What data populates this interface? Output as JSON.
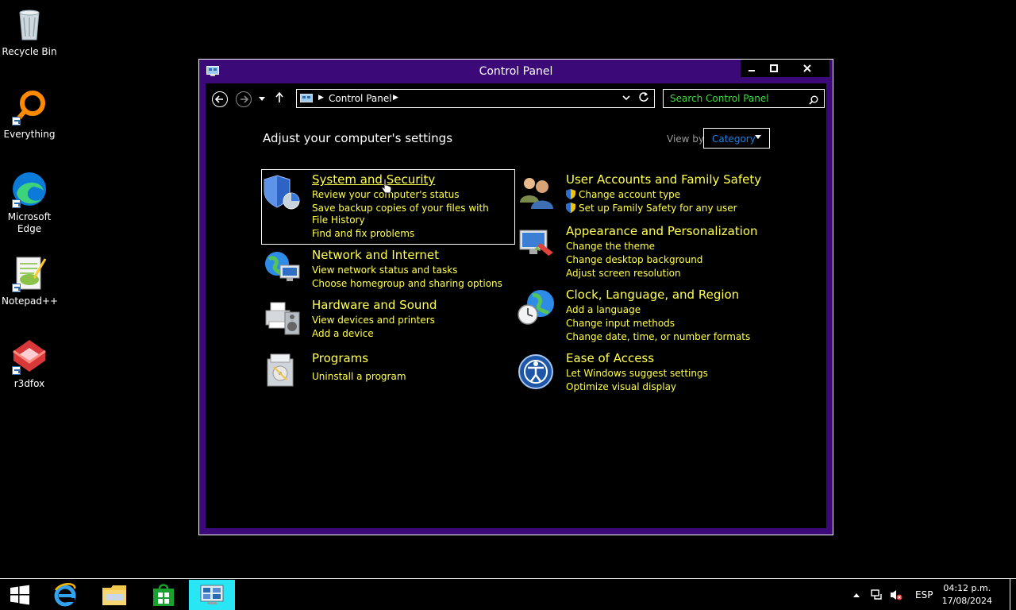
{
  "desktop": {
    "icons": [
      {
        "label": "Recycle Bin"
      },
      {
        "label": "Everything"
      },
      {
        "label": "Microsoft Edge"
      },
      {
        "label": "Notepad++"
      },
      {
        "label": "r3dfox"
      }
    ]
  },
  "window": {
    "title": "Control Panel",
    "controls": {
      "minimize": "–",
      "maximize": "□",
      "close": "✕"
    },
    "address": {
      "crumb": "Control Panel"
    },
    "search": {
      "placeholder": "Search Control Panel"
    },
    "heading": "Adjust your computer's settings",
    "view_by": {
      "label": "View by:",
      "value": "Category"
    },
    "categories": {
      "system": {
        "title": "System and Security",
        "links": [
          "Review your computer's status",
          "Save backup copies of your files with File History",
          "Find and fix problems"
        ]
      },
      "network": {
        "title": "Network and Internet",
        "links": [
          "View network status and tasks",
          "Choose homegroup and sharing options"
        ]
      },
      "hardware": {
        "title": "Hardware and Sound",
        "links": [
          "View devices and printers",
          "Add a device"
        ]
      },
      "programs": {
        "title": "Programs",
        "links": [
          "Uninstall a program"
        ]
      },
      "users": {
        "title": "User Accounts and Family Safety",
        "links": [
          "Change account type",
          "Set up Family Safety for any user"
        ]
      },
      "appearance": {
        "title": "Appearance and Personalization",
        "links": [
          "Change the theme",
          "Change desktop background",
          "Adjust screen resolution"
        ]
      },
      "clock": {
        "title": "Clock, Language, and Region",
        "links": [
          "Add a language",
          "Change input methods",
          "Change date, time, or number formats"
        ]
      },
      "ease": {
        "title": "Ease of Access",
        "links": [
          "Let Windows suggest settings",
          "Optimize visual display"
        ]
      }
    }
  },
  "taskbar": {
    "language": "ESP",
    "time": "04:12 p.m.",
    "date": "17/08/2024"
  },
  "colors": {
    "window_frame": "#3b0a78",
    "link": "#ffff4c",
    "search_text": "#41d844",
    "active_task": "#29e6f5"
  }
}
